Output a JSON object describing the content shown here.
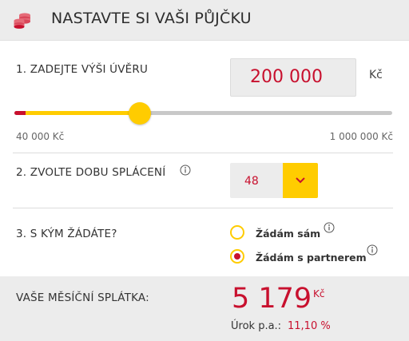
{
  "colors": {
    "accent_red": "#c8102e",
    "accent_yellow": "#ffcc00",
    "panel_gray": "#ececec"
  },
  "header": {
    "icon": "coins-icon",
    "title": "NASTAVTE SI VAŠI PŮJČKU"
  },
  "loan_amount": {
    "label": "1. ZADEJTE VÝŠI ÚVĚRU",
    "value": "200 000",
    "currency": "Kč",
    "slider": {
      "min_label": "40 000 Kč",
      "max_label": "1 000 000 Kč",
      "min": 40000,
      "max": 1000000,
      "value": 200000
    }
  },
  "repayment": {
    "label": "2. ZVOLTE DOBU SPLÁCENÍ",
    "info_icon": "info-icon",
    "selected": "48",
    "arrow_icon": "chevron-down-icon"
  },
  "applicant": {
    "label": "3. S KÝM ŽÁDÁTE?",
    "options": [
      {
        "label": "Žádám sám",
        "checked": false
      },
      {
        "label": "Žádám s partnerem",
        "checked": true
      }
    ]
  },
  "result": {
    "label": "VAŠE MĚSÍČNÍ SPLÁTKA:",
    "payment": "5 179",
    "currency": "Kč",
    "rate_label": "Úrok p.a.:",
    "rate_value": "11,10 %"
  }
}
